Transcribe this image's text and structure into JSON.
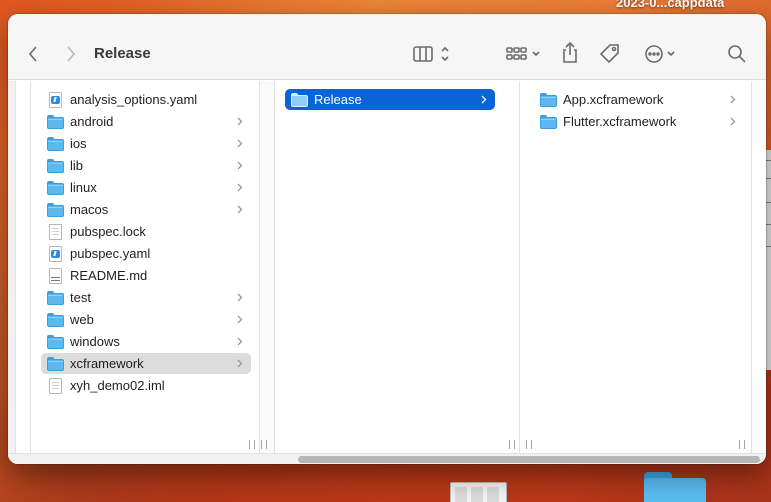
{
  "desktop": {
    "top_right_label": "2023-0...cappdata"
  },
  "window": {
    "title": "Release"
  },
  "toolbar": {
    "back_icon": "chevron-left-icon",
    "forward_icon": "chevron-right-icon",
    "view_icon": "column-view-icon",
    "group_icon": "grid-group-icon",
    "share_icon": "share-icon",
    "tag_icon": "tag-icon",
    "action_icon": "ellipsis-circle-icon",
    "search_icon": "magnifier-icon"
  },
  "columns": [
    {
      "items": [
        {
          "label": "analysis_options.yaml",
          "kind": "yaml",
          "has_children": false
        },
        {
          "label": "android",
          "kind": "folder",
          "has_children": true
        },
        {
          "label": "ios",
          "kind": "folder",
          "has_children": true
        },
        {
          "label": "lib",
          "kind": "folder",
          "has_children": true
        },
        {
          "label": "linux",
          "kind": "folder",
          "has_children": true
        },
        {
          "label": "macos",
          "kind": "folder",
          "has_children": true
        },
        {
          "label": "pubspec.lock",
          "kind": "doc",
          "has_children": false
        },
        {
          "label": "pubspec.yaml",
          "kind": "yaml",
          "has_children": false
        },
        {
          "label": "README.md",
          "kind": "md",
          "has_children": false
        },
        {
          "label": "test",
          "kind": "folder",
          "has_children": true
        },
        {
          "label": "web",
          "kind": "folder",
          "has_children": true
        },
        {
          "label": "windows",
          "kind": "folder",
          "has_children": true
        },
        {
          "label": "xcframework",
          "kind": "folder",
          "has_children": true,
          "selected": "inactive"
        },
        {
          "label": "xyh_demo02.iml",
          "kind": "doc",
          "has_children": false
        }
      ]
    },
    {
      "items": [
        {
          "label": "Release",
          "kind": "folder",
          "has_children": true,
          "selected": "active"
        }
      ]
    },
    {
      "items": [
        {
          "label": "App.xcframework",
          "kind": "folder",
          "has_children": true
        },
        {
          "label": "Flutter.xcframework",
          "kind": "folder",
          "has_children": true
        }
      ]
    }
  ],
  "colors": {
    "selection_active": "#0a64d6",
    "selection_inactive": "#dcdcdc",
    "folder": "#5cb8ee"
  }
}
